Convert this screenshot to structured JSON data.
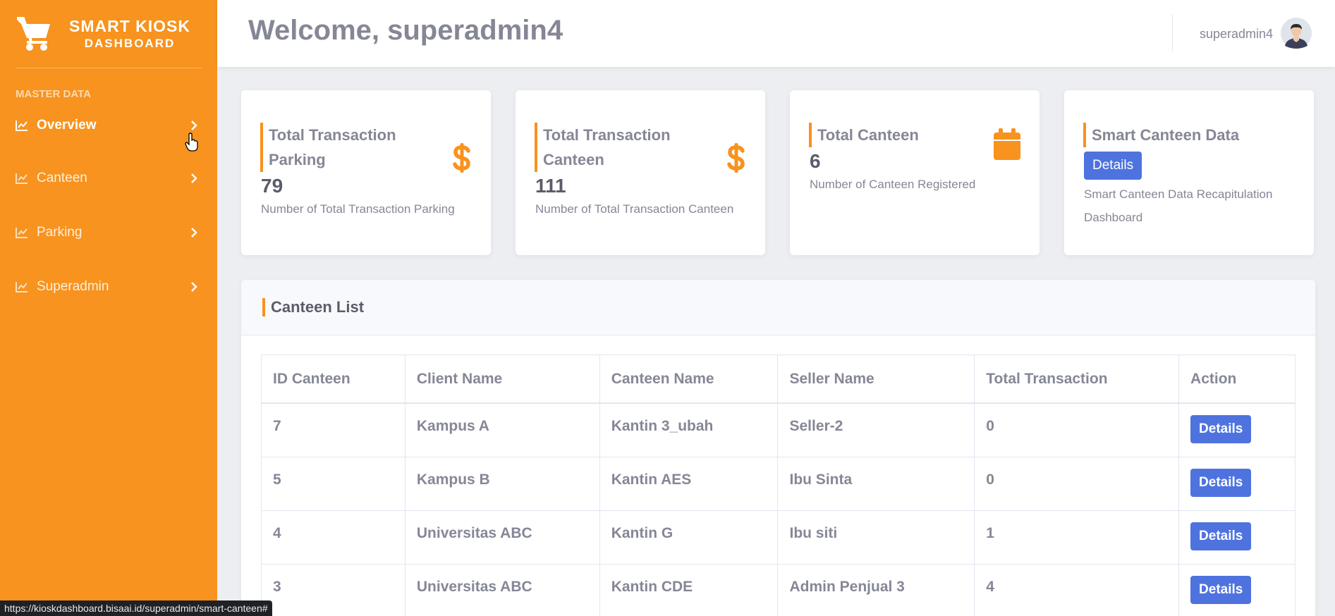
{
  "brand": {
    "title": "SMART KIOSK",
    "subtitle": "DASHBOARD",
    "icon": "shopping-cart-icon"
  },
  "sidebar": {
    "section_label": "MASTER DATA",
    "items": [
      {
        "label": "Overview",
        "active": true
      },
      {
        "label": "Canteen",
        "active": false
      },
      {
        "label": "Parking",
        "active": false
      },
      {
        "label": "Superadmin",
        "active": false
      }
    ]
  },
  "topbar": {
    "welcome": "Welcome, superadmin4",
    "username": "superadmin4"
  },
  "cards": [
    {
      "title_line1": "Total Transaction",
      "title_line2": "Parking",
      "value": "79",
      "desc": "Number of Total Transaction Parking",
      "icon": "dollar-icon"
    },
    {
      "title_line1": "Total Transaction",
      "title_line2": "Canteen",
      "value": "111",
      "desc": "Number of Total Transaction Canteen",
      "icon": "dollar-icon"
    },
    {
      "title": "Total Canteen",
      "value": "6",
      "desc": "Number of Canteen Registered",
      "icon": "calendar-icon"
    },
    {
      "title": "Smart Canteen Data",
      "button": "Details",
      "desc_line1": "Smart Canteen Data Recapitulation",
      "desc_line2": "Dashboard"
    }
  ],
  "canteen_list": {
    "title": "Canteen List",
    "columns": [
      "ID Canteen",
      "Client Name",
      "Canteen Name",
      "Seller Name",
      "Total Transaction",
      "Action"
    ],
    "rows": [
      {
        "id": "7",
        "client": "Kampus A",
        "canteen": "Kantin 3_ubah",
        "seller": "Seller-2",
        "total": "0",
        "action": "Details"
      },
      {
        "id": "5",
        "client": "Kampus B",
        "canteen": "Kantin AES",
        "seller": "Ibu Sinta",
        "total": "0",
        "action": "Details"
      },
      {
        "id": "4",
        "client": "Universitas ABC",
        "canteen": "Kantin G",
        "seller": "Ibu siti",
        "total": "1",
        "action": "Details"
      },
      {
        "id": "3",
        "client": "Universitas ABC",
        "canteen": "Kantin CDE",
        "seller": "Admin Penjual 3",
        "total": "4",
        "action": "Details"
      }
    ]
  },
  "status_bar": {
    "url": "https://kioskdashboard.bisaai.id/superadmin/smart-canteen#"
  },
  "colors": {
    "sidebar": "#f7931e",
    "accent": "#f7931e",
    "button": "#4e73df"
  }
}
